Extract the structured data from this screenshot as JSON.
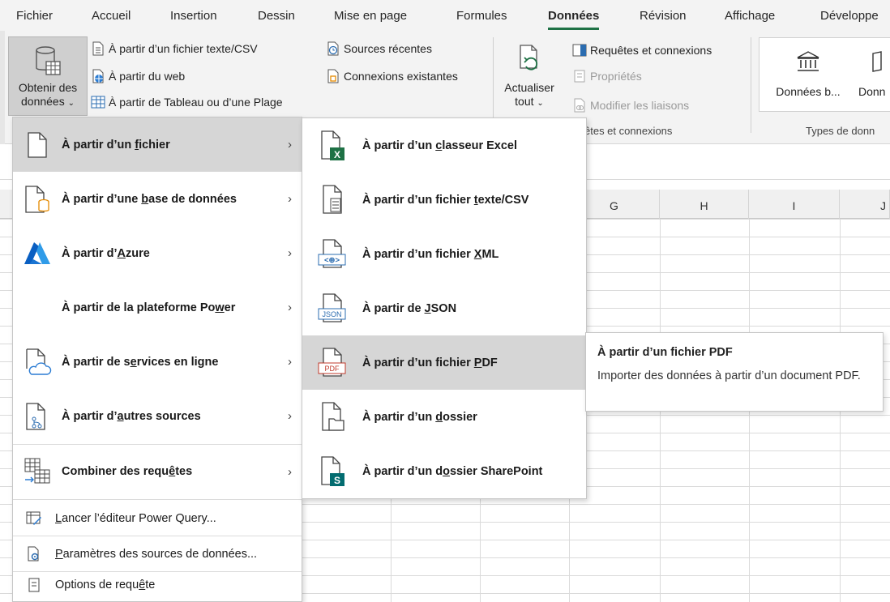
{
  "tabs": [
    "Fichier",
    "Accueil",
    "Insertion",
    "Dessin",
    "Mise en page",
    "Formules",
    "Données",
    "Révision",
    "Affichage",
    "Développe"
  ],
  "active_tab": "Données",
  "accent_color": "#1e7145",
  "ribbon": {
    "get_data_line1": "Obtenir des",
    "get_data_line2": "données",
    "from_text_csv": "À partir d’un fichier texte/CSV",
    "from_web": "À partir du web",
    "from_table": "À partir de Tableau ou d’une Plage",
    "recent_sources": "Sources récentes",
    "existing_connections": "Connexions existantes",
    "refresh_line1": "Actualiser",
    "refresh_line2": "tout",
    "queries_connections": "Requêtes et connexions",
    "properties": "Propriétés",
    "edit_links": "Modifier les liaisons",
    "group_queries_label": "êtes et connexions",
    "data_types_item1": "Données b...",
    "data_types_item2": "Donn",
    "group_types_label": "Types de donn"
  },
  "columns": [
    "G",
    "H",
    "I",
    "J"
  ],
  "menu1": {
    "items": [
      {
        "pre": "À partir d’un ",
        "u": "f",
        "post": "ichier",
        "icon": "file-icon",
        "has_sub": true,
        "highlighted": true
      },
      {
        "pre": "À partir d’une ",
        "u": "b",
        "post": "ase de données",
        "icon": "database-icon",
        "has_sub": true
      },
      {
        "pre": "À partir d’",
        "u": "A",
        "post": "zure",
        "icon": "azure-icon",
        "has_sub": true
      },
      {
        "pre": "À partir de la plateforme Po",
        "u": "w",
        "post": "er",
        "icon": "",
        "has_sub": true
      },
      {
        "pre": "À partir de s",
        "u": "e",
        "post": "rvices en ligne",
        "icon": "cloud-file-icon",
        "has_sub": true
      },
      {
        "pre": "À partir d’",
        "u": "a",
        "post": "utres sources",
        "icon": "other-sources-icon",
        "has_sub": true
      },
      {
        "pre": "Combiner des requ",
        "u": "ê",
        "post": "tes",
        "icon": "combine-queries-icon",
        "has_sub": true
      }
    ],
    "bottom": [
      {
        "pre": "",
        "u": "L",
        "post": "ancer l’éditeur Power Query...",
        "icon": "power-query-editor-icon"
      },
      {
        "pre": "",
        "u": "P",
        "post": "aramètres des sources de données...",
        "icon": "data-source-settings-icon"
      },
      {
        "pre": "Options de requ",
        "u": "ê",
        "post": "te",
        "icon": "query-options-icon"
      }
    ]
  },
  "menu2": {
    "items": [
      {
        "pre": "À partir d’un ",
        "u": "c",
        "post": "lasseur Excel",
        "icon": "excel-workbook-icon"
      },
      {
        "pre": "À partir d’un fichier ",
        "u": "t",
        "post": "exte/CSV",
        "icon": "text-file-icon"
      },
      {
        "pre": "À partir d’un fichier ",
        "u": "X",
        "post": "ML",
        "icon": "xml-file-icon"
      },
      {
        "pre": "À partir de ",
        "u": "J",
        "post": "SON",
        "icon": "json-file-icon"
      },
      {
        "pre": "À partir d’un fichier ",
        "u": "P",
        "post": "DF",
        "icon": "pdf-file-icon",
        "highlighted": true
      },
      {
        "pre": "À partir d’un ",
        "u": "d",
        "post": "ossier",
        "icon": "folder-icon"
      },
      {
        "pre": "À partir d’un d",
        "u": "o",
        "post": "ssier SharePoint",
        "icon": "sharepoint-folder-icon"
      }
    ],
    "icon_labels": {
      "xml": "<⊕>",
      "json": "JSON",
      "pdf": "PDF",
      "excel": "X",
      "sharepoint": "S"
    }
  },
  "tooltip": {
    "title": "À partir d’un fichier PDF",
    "description": "Importer des données à partir d’un document PDF."
  }
}
